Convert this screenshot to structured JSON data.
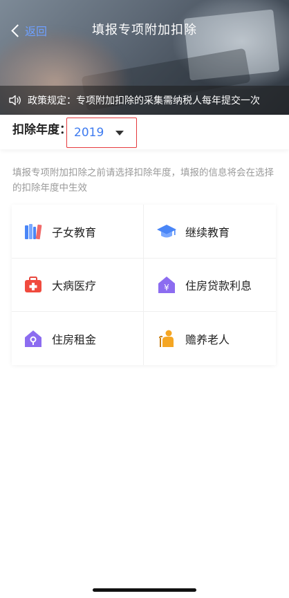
{
  "header": {
    "back_label": "返回",
    "title": "填报专项附加扣除"
  },
  "notice": {
    "text": "政策规定：专项附加扣除的采集需纳税人每年提交一次"
  },
  "year": {
    "label": "扣除年度：",
    "value": "2019"
  },
  "hint": "填报专项附加扣除之前请选择扣除年度，填报的信息将会在选择的扣除年度中生效",
  "items": [
    {
      "label": "子女教育",
      "icon": "books-icon",
      "color": "#3e7bf0"
    },
    {
      "label": "继续教育",
      "icon": "graduation-cap-icon",
      "color": "#3e7bf0"
    },
    {
      "label": "大病医疗",
      "icon": "medical-kit-icon",
      "color": "#f04a3e"
    },
    {
      "label": "住房贷款利息",
      "icon": "house-yen-icon",
      "color": "#8c6cf0"
    },
    {
      "label": "住房租金",
      "icon": "house-key-icon",
      "color": "#8c6cf0"
    },
    {
      "label": "赡养老人",
      "icon": "elderly-person-icon",
      "color": "#f5a623"
    }
  ]
}
